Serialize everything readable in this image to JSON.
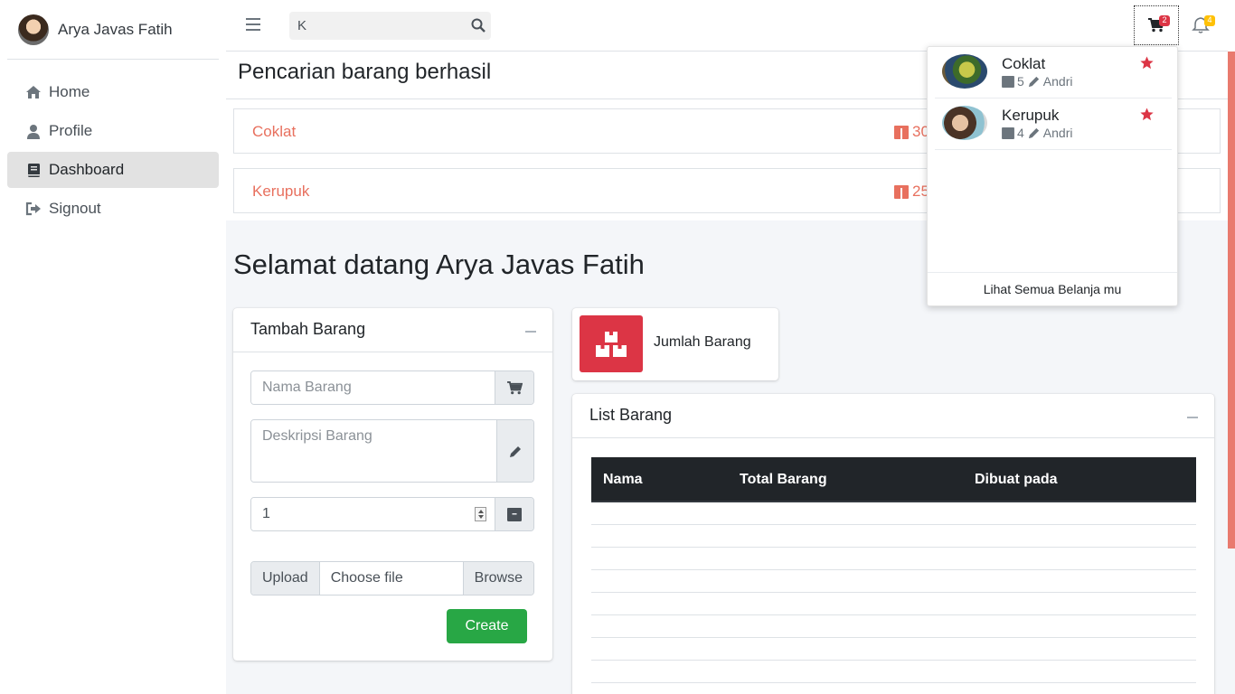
{
  "user": {
    "name": "Arya Javas Fatih"
  },
  "sidebar": {
    "items": [
      {
        "label": "Home",
        "icon": "home-icon"
      },
      {
        "label": "Profile",
        "icon": "user-icon"
      },
      {
        "label": "Dashboard",
        "icon": "book-icon",
        "active": true
      },
      {
        "label": "Signout",
        "icon": "sign-out-icon"
      }
    ]
  },
  "topbar": {
    "search_value": "K",
    "cart_count": "2",
    "notif_count": "4"
  },
  "search_results": {
    "title": "Pencarian barang berhasil",
    "items": [
      {
        "name": "Coklat",
        "qty": "30"
      },
      {
        "name": "Kerupuk",
        "qty": "25"
      }
    ]
  },
  "welcome": "Selamat datang Arya Javas Fatih",
  "tambah": {
    "title": "Tambah Barang",
    "name_placeholder": "Nama Barang",
    "desc_placeholder": "Deskripsi Barang",
    "qty_value": "1",
    "upload_label": "Upload",
    "choose_label": "Choose file",
    "browse_label": "Browse",
    "create_label": "Create"
  },
  "info_box": {
    "label": "Jumlah Barang"
  },
  "list": {
    "title": "List Barang",
    "columns": [
      "Nama",
      "Total Barang",
      "Dibuat pada"
    ]
  },
  "cart_dropdown": {
    "items": [
      {
        "name": "Coklat",
        "qty": "5",
        "author": "Andri"
      },
      {
        "name": "Kerupuk",
        "qty": "4",
        "author": "Andri"
      }
    ],
    "footer": "Lihat Semua Belanja mu"
  },
  "colors": {
    "accent_red": "#dc3545",
    "link_salmon": "#e8705e",
    "success": "#28a745",
    "dark_header": "#212529"
  }
}
